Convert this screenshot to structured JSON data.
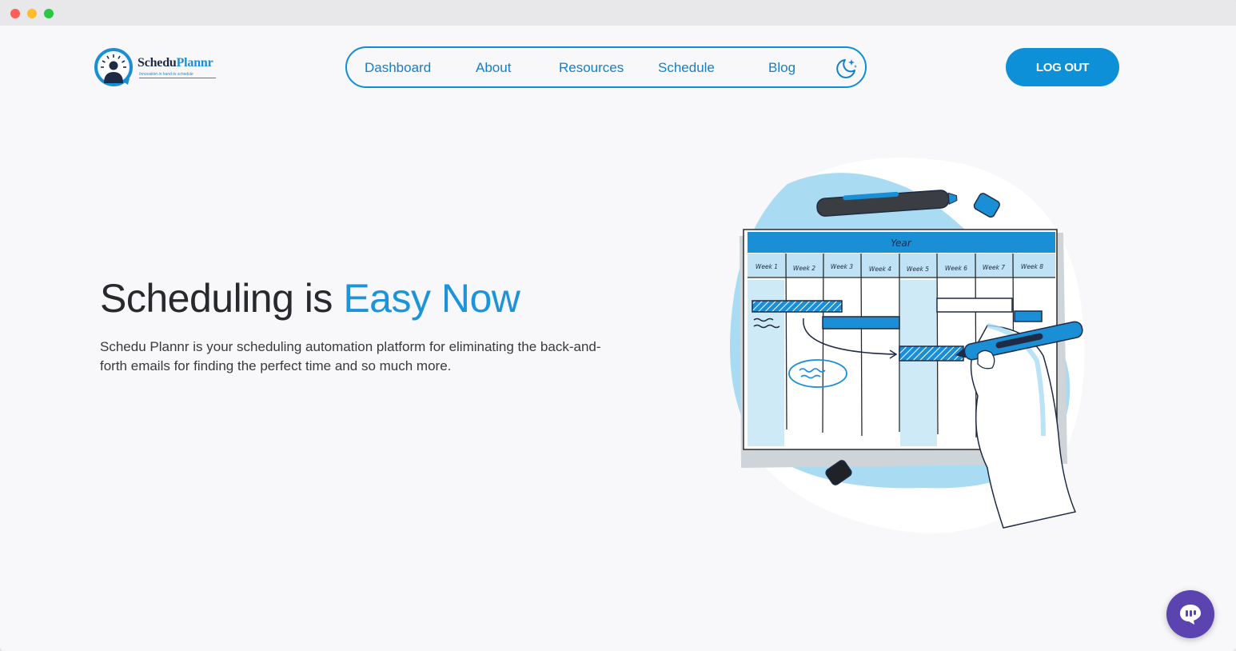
{
  "brand": {
    "name_prefix": "Schedu",
    "name_suffix": "Plannr",
    "tagline": "Innovation in hand to schedule",
    "accent_color": "#0d90d8"
  },
  "nav": {
    "items": [
      {
        "label": "Dashboard"
      },
      {
        "label": "About"
      },
      {
        "label": "Resources"
      },
      {
        "label": "Schedule"
      },
      {
        "label": "Blog"
      }
    ],
    "theme_toggle_icon": "moon-stars-icon"
  },
  "header": {
    "logout_label": "LOG OUT"
  },
  "hero": {
    "title_plain": "Scheduling is ",
    "title_highlight": "Easy Now",
    "description": "Schedu Plannr is your scheduling automation platform for eliminating the back-and-forth emails for finding the perfect time and so much more."
  },
  "illustration": {
    "board_title": "Year",
    "weeks": [
      "Week 1",
      "Week 2",
      "Week 3",
      "Week 4",
      "Week 5",
      "Week 6",
      "Week 7",
      "Week 8"
    ]
  },
  "chat": {
    "icon": "chat-bubble-icon",
    "color": "#5c44b0"
  }
}
